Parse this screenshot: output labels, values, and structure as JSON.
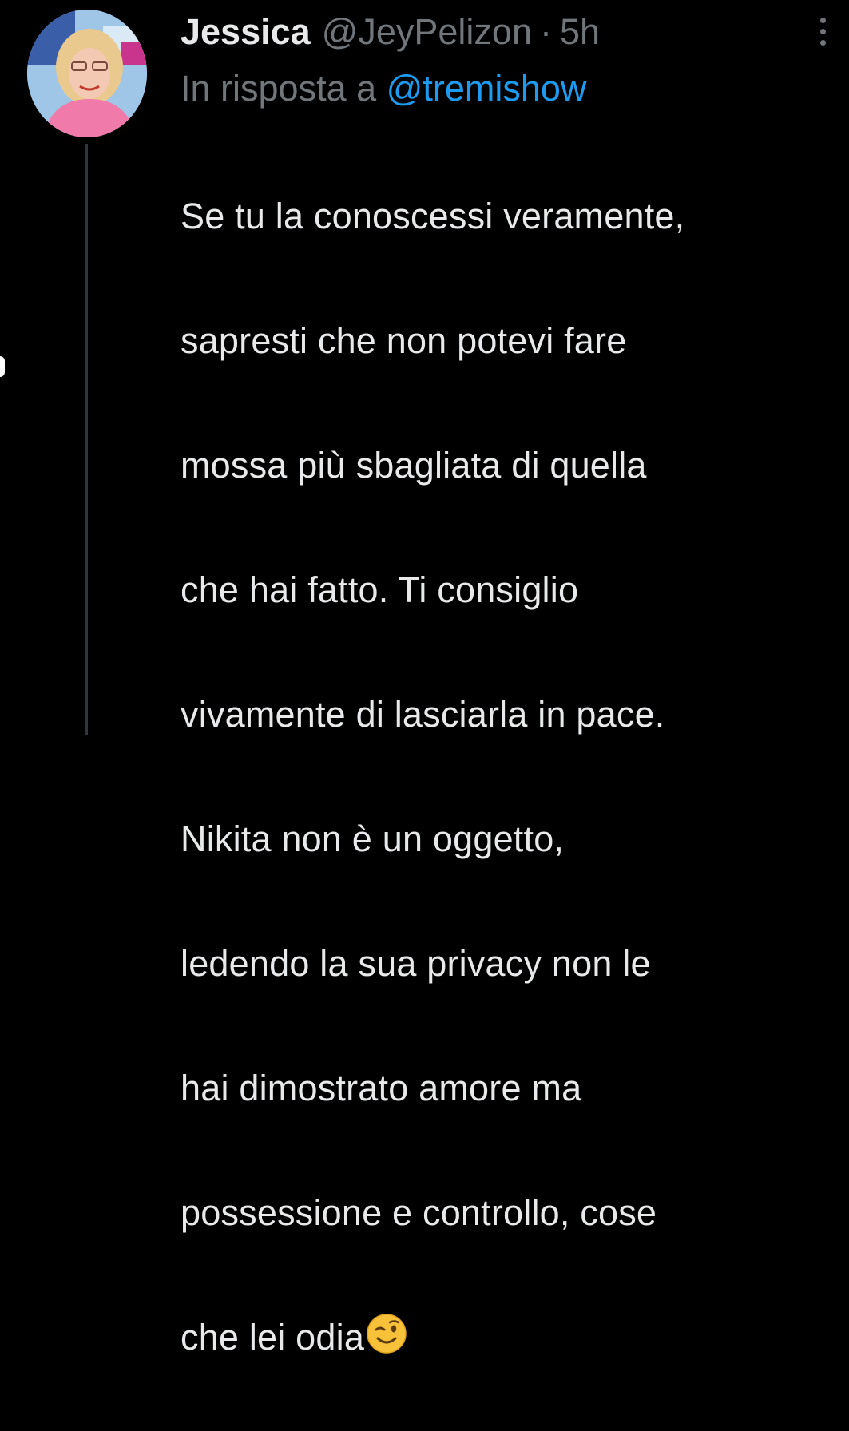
{
  "tweet": {
    "author_name": "Jessica",
    "author_handle": "@JeyPelizon",
    "separator": "·",
    "timestamp": "5h",
    "reply_prefix": "In risposta a",
    "reply_to_handle": "@tremishow",
    "text_lines": [
      "Se tu la conoscessi veramente,",
      "sapresti che non potevi fare",
      "mossa più sbagliata di quella",
      "che hai fatto. Ti consiglio",
      "vivamente di lasciarla in pace.",
      "Nikita non è un oggetto,",
      "ledendo la sua privacy non le",
      "hai dimostrato amore ma",
      "possessione e controllo, cose",
      "che lei odia"
    ],
    "trailing_emoji": "winking-face-emoji"
  },
  "icons": {
    "more": "more-options-icon",
    "avatar": "avatar"
  },
  "colors": {
    "background": "#000000",
    "primary_text": "#e7e9ea",
    "secondary_text": "#71767b",
    "link": "#1d9bf0",
    "thread_line": "#333639"
  }
}
